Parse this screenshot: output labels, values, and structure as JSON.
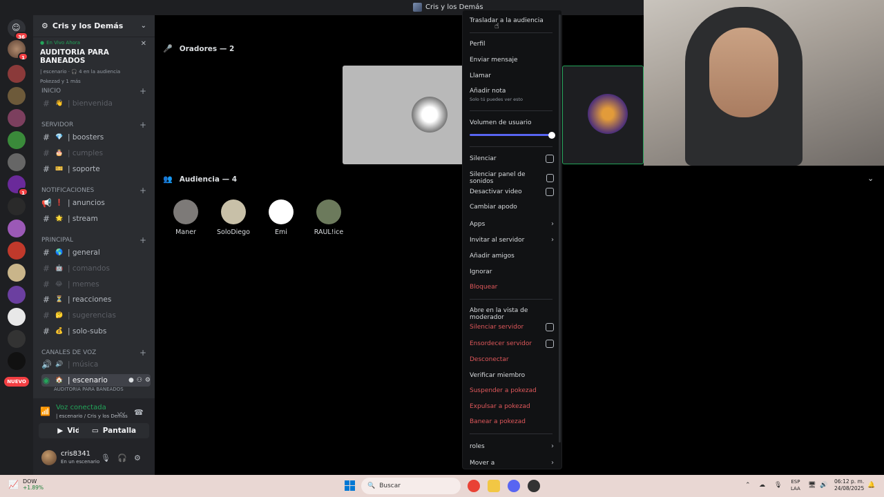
{
  "window": {
    "title": "Cris y los Demás"
  },
  "rail": {
    "home_badge": "36",
    "badge_2": "1",
    "badge_3": "1",
    "new_label": "NUEVO"
  },
  "sidebar": {
    "server_name": "Cris y los Demás",
    "live": {
      "label": "En Vivo Ahora",
      "title": "AUDITORIA PARA BANEADOS",
      "meta": "| escenario · 🎧 4 en la audiencia",
      "meta2": "Pokezad y 1 más"
    },
    "categories": {
      "inicio": "INICIO",
      "servidor": "SERVIDOR",
      "notificaciones": "NOTIFICACIONES",
      "principal": "PRINCIPAL",
      "voz": "CANALES DE VOZ"
    },
    "channels": {
      "bienvenida": "| bienvenida",
      "boosters": "| boosters",
      "cumples": "| cumples",
      "soporte": "| soporte",
      "anuncios": "| anuncios",
      "stream": "| stream",
      "general": "| general",
      "comandos": "| comandos",
      "memes": "| memes",
      "reacciones": "| reacciones",
      "sugerencias": "| sugerencias",
      "solo_subs": "| solo-subs",
      "musica": "| música",
      "escenario": "| escenario"
    },
    "escenario_sub": "AUDITORIA PARA BANEADOS",
    "voice": {
      "status": "Voz conectada",
      "location": "| escenario / Cris y los Demás",
      "video_label": "Video",
      "screen_label": "Pantalla"
    },
    "user": {
      "name": "cris8341",
      "status": "En un escenario"
    }
  },
  "stage": {
    "speakers_header": "Oradores — 2",
    "audience_header": "Audiencia — 4",
    "audience": [
      {
        "name": "Maner",
        "color": "#7d7a78"
      },
      {
        "name": "SoloDiego",
        "color": "#c8c0a8"
      },
      {
        "name": "Emi",
        "color": "#ffffff"
      },
      {
        "name": "RAUL!ice",
        "color": "#6c7a5c"
      }
    ]
  },
  "menu": {
    "items": {
      "move_audience": "Trasladar a la audiencia",
      "profile": "Perfil",
      "send_message": "Enviar mensaje",
      "call": "Llamar",
      "add_note": "Añadir nota",
      "add_note_sub": "Solo tú puedes ver esto",
      "user_volume": "Volumen de usuario",
      "mute": "Silenciar",
      "mute_soundboard": "Silenciar panel de sonidos",
      "disable_video": "Desactivar video",
      "change_nick": "Cambiar apodo",
      "apps": "Apps",
      "invite": "Invitar al servidor",
      "add_friends": "Añadir amigos",
      "ignore": "Ignorar",
      "block": "Bloquear",
      "mod_view": "Abre en la vista de moderador",
      "server_mute": "Silenciar servidor",
      "server_deafen": "Ensordecer servidor",
      "disconnect": "Desconectar",
      "verify": "Verificar miembro",
      "suspend": "Suspender a pokezad",
      "kick": "Expulsar a pokezad",
      "ban": "Banear a pokezad",
      "roles": "roles",
      "move_to": "Mover a"
    },
    "volume_level": 1.0
  },
  "taskbar": {
    "stock_name": "DOW",
    "stock_change": "+1.89%",
    "search_placeholder": "Buscar",
    "lang_1": "ESP",
    "lang_2": "LAA",
    "time": "06:12 p. m.",
    "date": "24/08/2025"
  }
}
